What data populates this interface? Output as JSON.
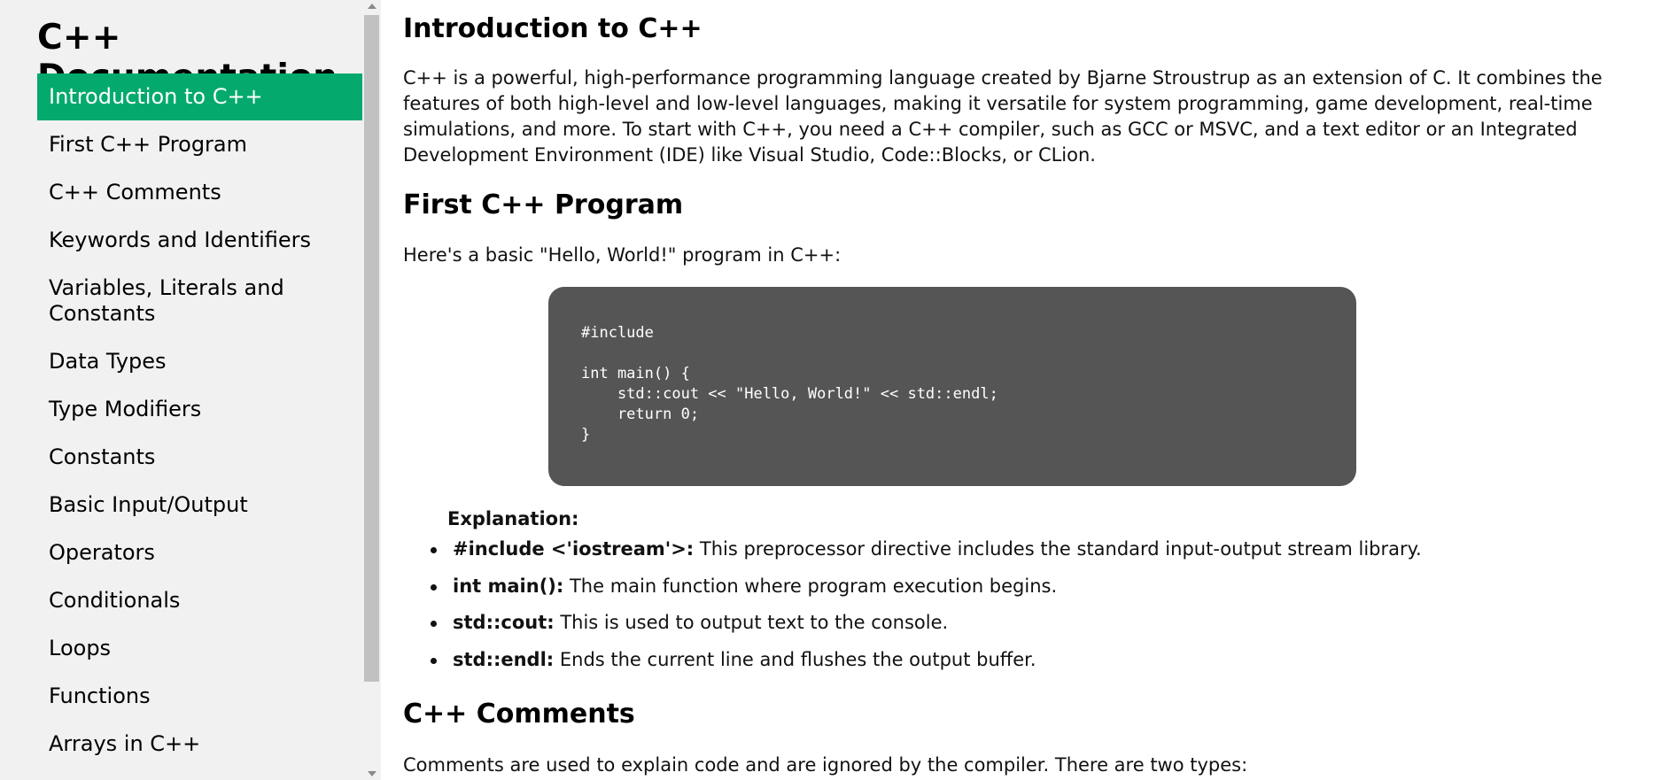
{
  "sidebar": {
    "title": "C++ Documentation",
    "items": [
      {
        "label": "Introduction to C++",
        "active": true
      },
      {
        "label": "First C++ Program"
      },
      {
        "label": "C++ Comments"
      },
      {
        "label": "Keywords and Identifiers"
      },
      {
        "label": "Variables, Literals and Constants"
      },
      {
        "label": "Data Types"
      },
      {
        "label": "Type Modifiers"
      },
      {
        "label": "Constants"
      },
      {
        "label": "Basic Input/Output"
      },
      {
        "label": "Operators"
      },
      {
        "label": "Conditionals"
      },
      {
        "label": "Loops"
      },
      {
        "label": "Functions"
      },
      {
        "label": "Arrays in C++"
      }
    ],
    "active_color": "#04aa6d"
  },
  "main": {
    "intro": {
      "heading": "Introduction to C++",
      "paragraph": "C++ is a powerful, high-performance programming language created by Bjarne Stroustrup as an extension of C. It combines the features of both high-level and low-level languages, making it versatile for system programming, game development, real-time simulations, and more. To start with C++, you need a C++ compiler, such as GCC or MSVC, and a text editor or an Integrated Development Environment (IDE) like Visual Studio, Code::Blocks, or CLion."
    },
    "first_program": {
      "heading": "First C++ Program",
      "paragraph": "Here's a basic \"Hello, World!\" program in C++:",
      "code": "#include \n\nint main() {\n    std::cout << \"Hello, World!\" << std::endl;\n    return 0;\n}",
      "explanation_label": "Explanation:",
      "bullets": [
        {
          "term": "#include <'iostream'>:",
          "text": " This preprocessor directive includes the standard input-output stream library."
        },
        {
          "term": "int main():",
          "text": " The main function where program execution begins."
        },
        {
          "term": "std::cout:",
          "text": " This is used to output text to the console."
        },
        {
          "term": "std::endl:",
          "text": " Ends the current line and flushes the output buffer."
        }
      ]
    },
    "comments": {
      "heading": "C++ Comments",
      "paragraph": "Comments are used to explain code and are ignored by the compiler. There are two types:"
    }
  }
}
